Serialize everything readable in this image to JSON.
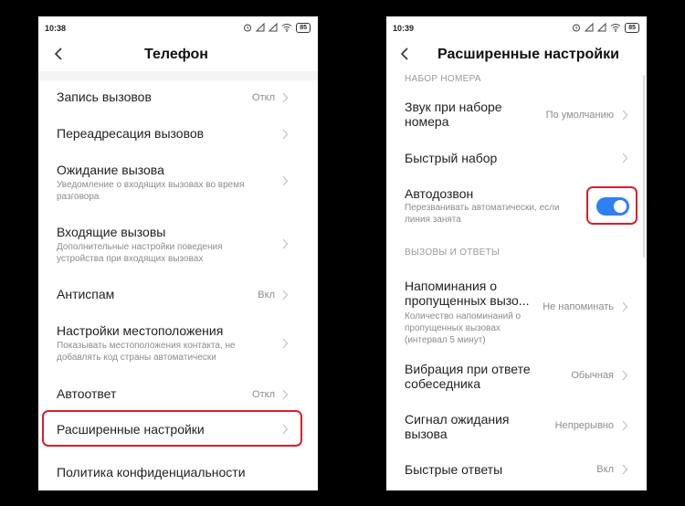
{
  "left_phone": {
    "status": {
      "time": "10:38",
      "battery": "85"
    },
    "title": "Телефон",
    "items": [
      {
        "title": "Запись вызовов",
        "value": "Откл"
      },
      {
        "title": "Переадресация вызовов"
      },
      {
        "title": "Ожидание вызова",
        "subtitle": "Уведомление о входящих вызовах во время разговора"
      },
      {
        "title": "Входящие вызовы",
        "subtitle": "Дополнительные настройки поведения устройства при входящих вызовах"
      },
      {
        "title": "Антиспам",
        "value": "Вкл"
      },
      {
        "title": "Настройки местоположения",
        "subtitle": "Показывать местоположения контакта, не добавлять код страны автоматически"
      },
      {
        "title": "Автоответ",
        "value": "Откл"
      },
      {
        "title": "Расширенные настройки"
      },
      {
        "title": "Политика конфиденциальности"
      }
    ]
  },
  "right_phone": {
    "status": {
      "time": "10:39",
      "battery": "85"
    },
    "title": "Расширенные настройки",
    "section_dialing": "НАБОР НОМЕРА",
    "section_calls": "ВЫЗОВЫ И ОТВЕТЫ",
    "items": [
      {
        "title": "Звук при наборе номера",
        "value": "По умолчанию"
      },
      {
        "title": "Быстрый набор"
      },
      {
        "title": "Автодозвон",
        "subtitle": "Перезванивать автоматически, если линия занята",
        "toggle_on": true
      },
      {
        "title": "Напоминания о пропущенных вызо...",
        "subtitle": "Количество напоминаний о пропущенных вызовах (интервал 5 минут)",
        "value": "Не напоминать"
      },
      {
        "title": "Вибрация при ответе собеседника",
        "value": "Обычная"
      },
      {
        "title": "Сигнал ожидания вызова",
        "value": "Непрерывно"
      },
      {
        "title": "Быстрые ответы",
        "value": "Вкл"
      }
    ]
  },
  "colors": {
    "highlight": "#d8202a",
    "toggle": "#2f7ff5",
    "chevron": "#c2c2c2"
  },
  "icons": [
    "back-arrow-icon",
    "chevron-right-icon",
    "alarm-icon",
    "wifi-icon",
    "signal-icon",
    "toggle-switch"
  ]
}
